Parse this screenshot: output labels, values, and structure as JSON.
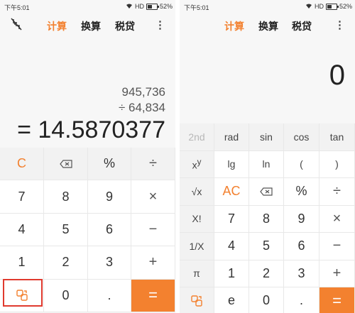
{
  "status": {
    "time": "下午5:01",
    "network": "HD",
    "battery_percent": "52%",
    "battery_level": 0.52
  },
  "tabs": [
    "计算",
    "换算",
    "税贷"
  ],
  "menu_icon": "⋮",
  "left": {
    "history": [
      "945,736",
      "÷  64,834"
    ],
    "result": "= 14.5870377",
    "keys": [
      [
        "C",
        "⌫",
        "%",
        "÷"
      ],
      [
        "7",
        "8",
        "9",
        "×"
      ],
      [
        "4",
        "5",
        "6",
        "−"
      ],
      [
        "1",
        "2",
        "3",
        "+"
      ],
      [
        "⇄",
        "0",
        ".",
        "="
      ]
    ]
  },
  "right": {
    "display": "0",
    "sci_row": [
      "2nd",
      "rad",
      "sin",
      "cos",
      "tan"
    ],
    "rows": [
      [
        "x^y",
        "lg",
        "ln",
        "(",
        ")"
      ],
      [
        "√x",
        "AC",
        "⌫",
        "%",
        "÷"
      ],
      [
        "X!",
        "7",
        "8",
        "9",
        "×"
      ],
      [
        "1/X",
        "4",
        "5",
        "6",
        "−"
      ],
      [
        "π",
        "1",
        "2",
        "3",
        "+"
      ],
      [
        "⇄",
        "e",
        "0",
        ".",
        "="
      ]
    ]
  },
  "colors": {
    "accent": "#f3812f",
    "highlight": "#e03a2e"
  },
  "icons": {
    "collapse": "collapse-icon",
    "mode_switch": "mode-switch-icon",
    "backspace": "backspace-icon"
  }
}
